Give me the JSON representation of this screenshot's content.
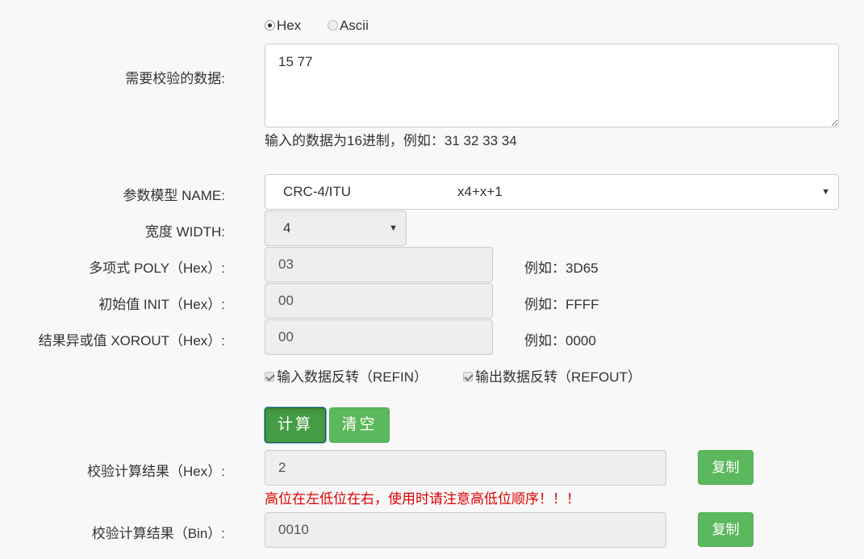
{
  "format": {
    "hex_label": "Hex",
    "ascii_label": "Ascii",
    "selected": "Hex"
  },
  "data_input": {
    "label": "需要校验的数据:",
    "value": "15 77",
    "hint": "输入的数据为16进制，例如：31 32 33 34"
  },
  "model": {
    "label": "参数模型 NAME:",
    "name": "CRC-4/ITU",
    "formula": "x4+x+1"
  },
  "width": {
    "label": "宽度 WIDTH:",
    "value": "4"
  },
  "poly": {
    "label": "多项式 POLY（Hex）:",
    "value": "03",
    "example": "例如：3D65"
  },
  "init": {
    "label": "初始值 INIT（Hex）:",
    "value": "00",
    "example": "例如：FFFF"
  },
  "xorout": {
    "label": "结果异或值 XOROUT（Hex）:",
    "value": "00",
    "example": "例如：0000"
  },
  "refin": {
    "label": "输入数据反转（REFIN）",
    "checked": true
  },
  "refout": {
    "label": "输出数据反转（REFOUT）",
    "checked": true
  },
  "buttons": {
    "calculate": "计算",
    "clear": "清空",
    "copy": "复制"
  },
  "result_hex": {
    "label": "校验计算结果（Hex）:",
    "value": "2",
    "warning": "高位在左低位在右，使用时请注意高低位顺序！！！"
  },
  "result_bin": {
    "label": "校验计算结果（Bin）:",
    "value": "0010"
  },
  "colors": {
    "button_green": "#5cb85c",
    "button_active": "#449d44",
    "warning_red": "#e00000"
  }
}
